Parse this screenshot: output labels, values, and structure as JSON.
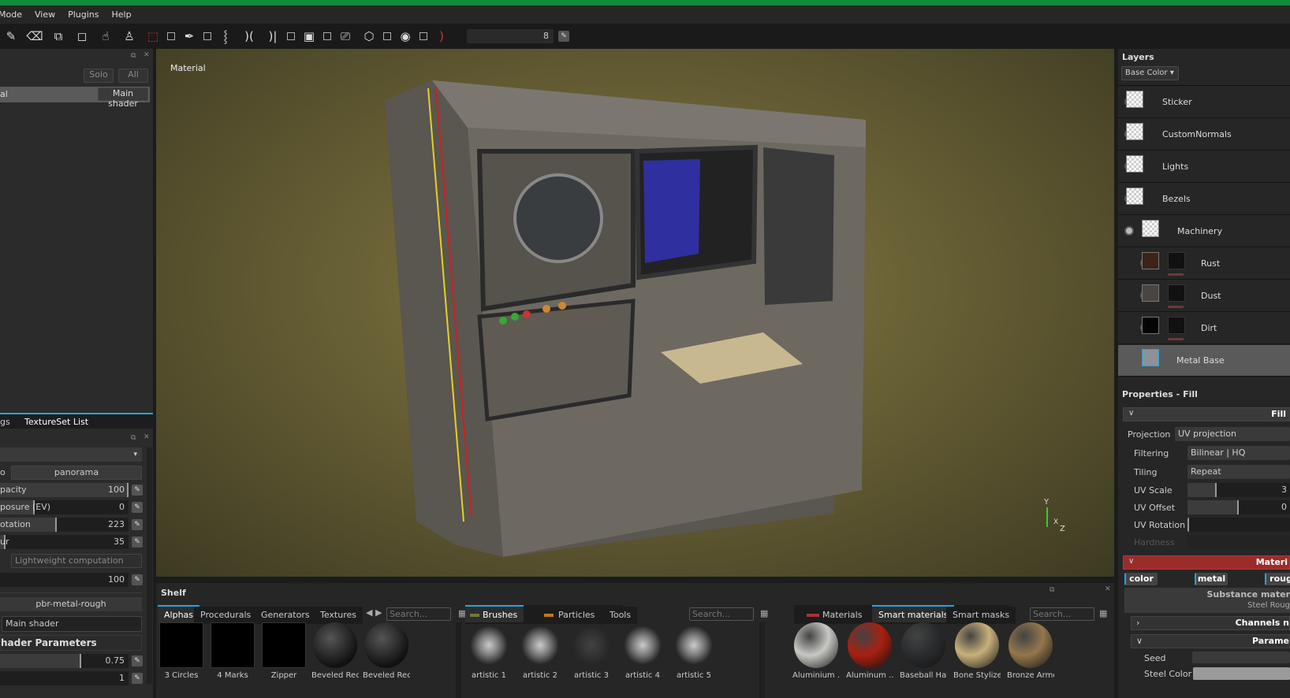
{
  "menu": [
    "Mode",
    "View",
    "Plugins",
    "Help"
  ],
  "toolbar": {
    "brush_size": "8"
  },
  "left_top": {
    "solo": "Solo",
    "all": "All",
    "row_label": "al",
    "shader": "Main shader"
  },
  "left_tabs": [
    "gs",
    "TextureSet List"
  ],
  "display": {
    "env_label": "o",
    "env_value": "panorama",
    "sliders": [
      {
        "label": "pacity",
        "value": "100",
        "pct": 100
      },
      {
        "label": "posure (EV)",
        "value": "0",
        "pct": 50
      },
      {
        "label": "otation",
        "value": "223",
        "pct": 42
      },
      {
        "label": "ur",
        "value": "35",
        "pct": 3
      }
    ],
    "computation": "Lightweight computation",
    "extra_value": "100",
    "shader_type": "pbr-metal-rough",
    "shader_name": "Main shader",
    "shader_params": "hader Parameters",
    "params": [
      {
        "value": "0.75",
        "pct": 60
      },
      {
        "value": "1",
        "pct": 0
      }
    ]
  },
  "viewport": {
    "label": "Material",
    "axes": {
      "y": "Y",
      "x": "X",
      "z": "Z"
    }
  },
  "layers": {
    "title": "Layers",
    "channel": "Base Color",
    "items": [
      {
        "name": "Sticker"
      },
      {
        "name": "CustomNormals"
      },
      {
        "name": "Lights"
      },
      {
        "name": "Bezels"
      },
      {
        "name": "Machinery"
      },
      {
        "name": "Rust"
      },
      {
        "name": "Dust"
      },
      {
        "name": "Dirt"
      },
      {
        "name": "Metal Base"
      }
    ]
  },
  "properties": {
    "title": "Properties - Fill",
    "fill": "Fill",
    "rows": [
      {
        "label": "Projection",
        "value": "UV projection"
      },
      {
        "label": "Filtering",
        "value": "Bilinear | HQ"
      },
      {
        "label": "Tiling",
        "value": "Repeat"
      }
    ],
    "uv_scale": {
      "label": "UV Scale",
      "value": "3",
      "pct": 25
    },
    "uv_offset": {
      "label": "UV Offset",
      "value": "0",
      "pct": 50
    },
    "uv_rotation": {
      "label": "UV Rotation"
    },
    "hardness": "Hardness",
    "material": "Materi",
    "channels": [
      "color",
      "metal",
      "roug"
    ],
    "substance": "Substance mater",
    "steel": "Steel Roug",
    "channels_section": "Channels n",
    "params_section": "Parame",
    "seed": "Seed",
    "steel_color": "Steel Color"
  },
  "shelf": {
    "title": "Shelf",
    "tabs1": [
      "Alphas",
      "Procedurals",
      "Generators",
      "Textures"
    ],
    "search": "Search...",
    "items1": [
      "3 Circles",
      "4 Marks",
      "Zipper",
      "Beveled Rec...",
      "Beveled Rec..."
    ],
    "tabs2": [
      "Brushes",
      "Particles",
      "Tools"
    ],
    "items2": [
      "artistic 1",
      "artistic 2",
      "artistic 3",
      "artistic 4",
      "artistic 5"
    ],
    "tabs3": [
      "Materials",
      "Smart materials",
      "Smart masks"
    ],
    "items3": [
      {
        "name": "Aluminium ...",
        "color": "#c8c8c4"
      },
      {
        "name": "Aluminum ...",
        "color": "#a82010"
      },
      {
        "name": "Baseball Hat...",
        "color": "#2a2c2e"
      },
      {
        "name": "Bone Stylized",
        "color": "#c8b07a"
      },
      {
        "name": "Bronze Armor",
        "color": "#94774c"
      }
    ]
  }
}
